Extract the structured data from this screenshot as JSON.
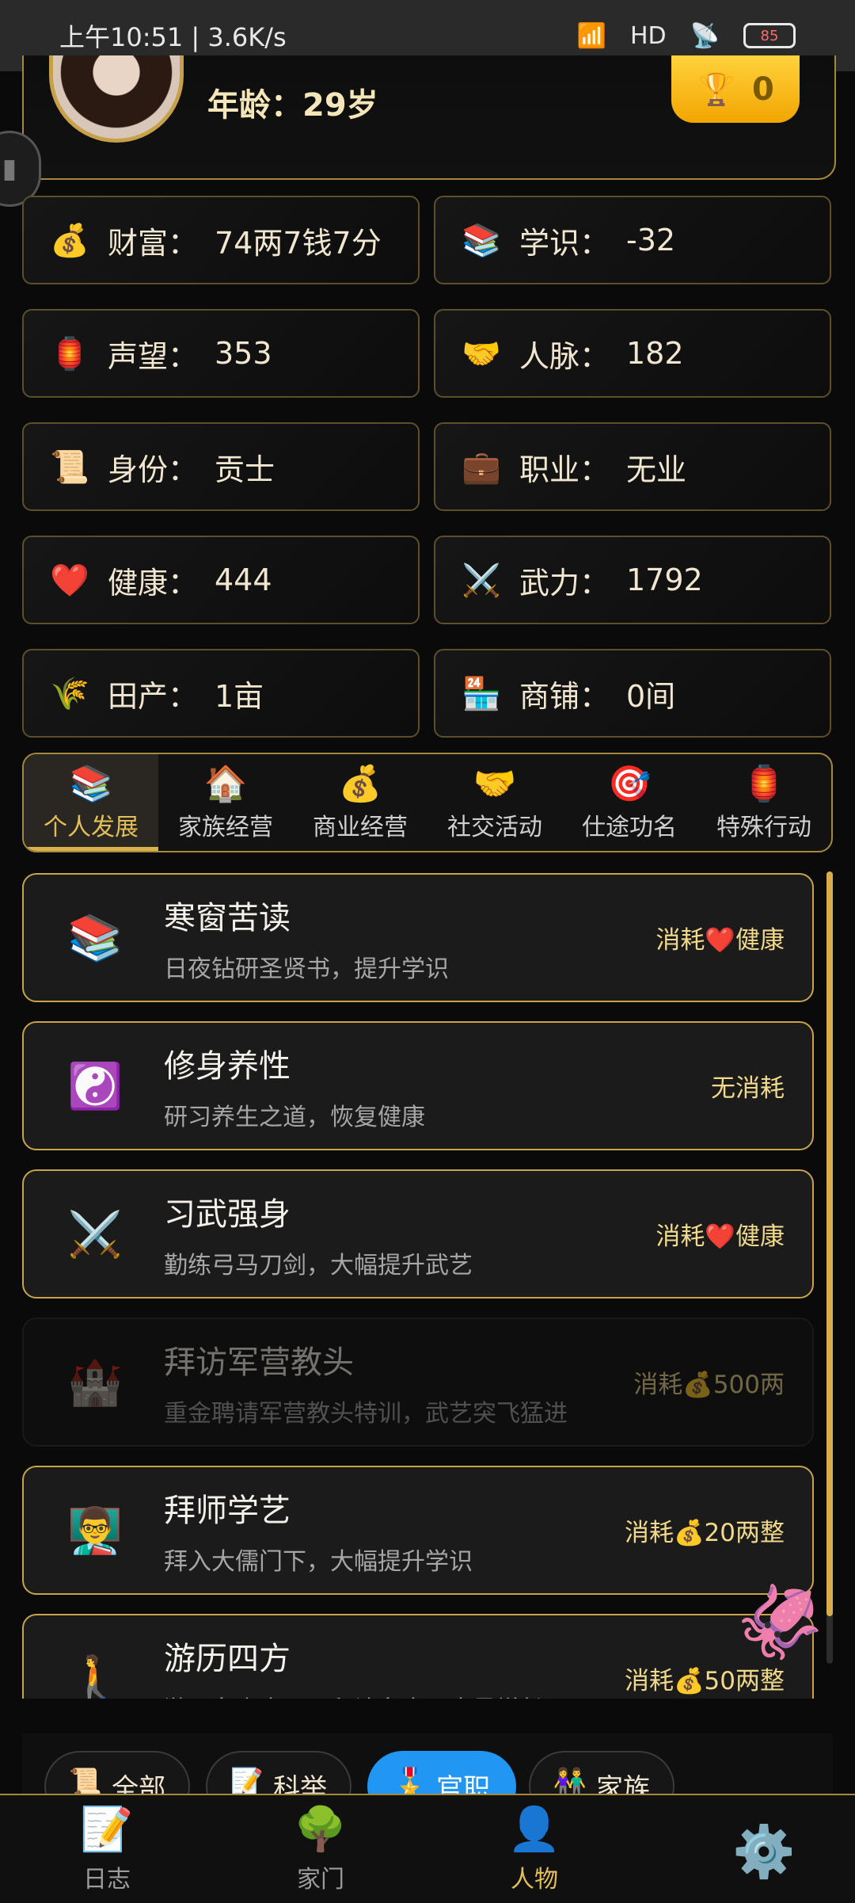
{
  "status_bar": {
    "time": "上午10:51 | 3.6K/s",
    "network": "HD",
    "battery": "85"
  },
  "profile": {
    "age": "年龄：29岁",
    "trophy_value": "0"
  },
  "stats": [
    {
      "icon": "💰",
      "label": "财富：",
      "value": "74两7钱7分"
    },
    {
      "icon": "📚",
      "label": "学识：",
      "value": "-32"
    },
    {
      "icon": "🏮",
      "label": "声望：",
      "value": "353"
    },
    {
      "icon": "🤝",
      "label": "人脉：",
      "value": "182"
    },
    {
      "icon": "📜",
      "label": "身份：",
      "value": "贡士"
    },
    {
      "icon": "💼",
      "label": "职业：",
      "value": "无业"
    },
    {
      "icon": "❤️",
      "label": "健康：",
      "value": "444"
    },
    {
      "icon": "⚔️",
      "label": "武力：",
      "value": "1792"
    },
    {
      "icon": "🌾",
      "label": "田产：",
      "value": "1亩"
    },
    {
      "icon": "🏪",
      "label": "商铺：",
      "value": "0间"
    }
  ],
  "tabs": [
    {
      "icon": "📚",
      "label": "个人发展"
    },
    {
      "icon": "🏠",
      "label": "家族经营"
    },
    {
      "icon": "💰",
      "label": "商业经营"
    },
    {
      "icon": "🤝",
      "label": "社交活动"
    },
    {
      "icon": "🎯",
      "label": "仕途功名"
    },
    {
      "icon": "🏮",
      "label": "特殊行动"
    }
  ],
  "actions": [
    {
      "icon": "📚",
      "title": "寒窗苦读",
      "desc": "日夜钻研圣贤书，提升学识",
      "cost": "消耗❤️健康"
    },
    {
      "icon": "☯️",
      "title": "修身养性",
      "desc": "研习养生之道，恢复健康",
      "cost": "无消耗"
    },
    {
      "icon": "⚔️",
      "title": "习武强身",
      "desc": "勤练弓马刀剑，大幅提升武艺",
      "cost": "消耗❤️健康"
    },
    {
      "icon": "🏰",
      "title": "拜访军营教头",
      "desc": "重金聘请军营教头特训，武艺突飞猛进",
      "cost": "消耗💰500两"
    },
    {
      "icon": "👨‍🏫",
      "title": "拜师学艺",
      "desc": "拜入大儒门下，大幅提升学识",
      "cost": "消耗💰20两整"
    },
    {
      "icon": "🚶",
      "title": "游历四方",
      "desc": "游历名山大川，拜访名人，大量增长",
      "cost": "消耗💰50两整"
    }
  ],
  "filters": [
    {
      "icon": "📜",
      "label": "全部"
    },
    {
      "icon": "📝",
      "label": "科举"
    },
    {
      "icon": "🎖️",
      "label": "官职"
    },
    {
      "icon": "👫",
      "label": "家族"
    }
  ],
  "nav": [
    {
      "icon": "📝",
      "label": "日志"
    },
    {
      "icon": "🌳",
      "label": "家门"
    },
    {
      "icon": "👤",
      "label": "人物"
    }
  ],
  "settings_icon": "⚙️"
}
